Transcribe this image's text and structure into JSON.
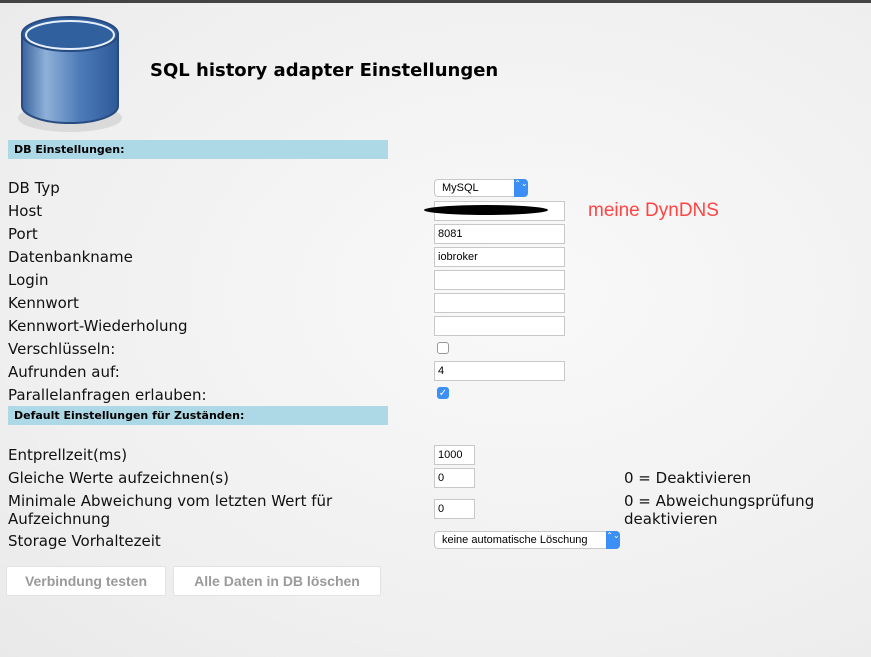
{
  "title": "SQL history adapter Einstellungen",
  "sections": {
    "db": "DB Einstellungen:",
    "defaults": "Default Einstellungen für Zuständen:"
  },
  "fields": {
    "db_type": {
      "label": "DB Typ",
      "value": "MySQL"
    },
    "host": {
      "label": "Host",
      "value": ""
    },
    "port": {
      "label": "Port",
      "value": "8081"
    },
    "dbname": {
      "label": "Datenbankname",
      "value": "iobroker"
    },
    "login": {
      "label": "Login",
      "value": ""
    },
    "password": {
      "label": "Kennwort",
      "value": ""
    },
    "password_repeat": {
      "label": "Kennwort-Wiederholung",
      "value": ""
    },
    "encrypt": {
      "label": "Verschlüsseln:",
      "checked": false
    },
    "round": {
      "label": "Aufrunden auf:",
      "value": "4"
    },
    "parallel": {
      "label": "Parallelanfragen erlauben:",
      "checked": true,
      "check": "✓"
    },
    "debounce": {
      "label": "Entprellzeit(ms)",
      "value": "1000"
    },
    "same_values": {
      "label": "Gleiche Werte aufzeichnen(s)",
      "value": "0",
      "note": "0 = Deaktivieren"
    },
    "min_diff": {
      "label1": "Minimale Abweichung vom letzten Wert für",
      "label2": "Aufzeichnung",
      "value": "0",
      "note1": "0 = Abweichungsprüfung",
      "note2": "deaktivieren"
    },
    "retention": {
      "label": "Storage Vorhaltezeit",
      "value": "keine automatische Löschung"
    }
  },
  "annotation": "meine DynDNS",
  "buttons": {
    "test": "Verbindung testen",
    "delete": "Alle Daten in DB löschen"
  },
  "select_arrows": "⌃⌄"
}
